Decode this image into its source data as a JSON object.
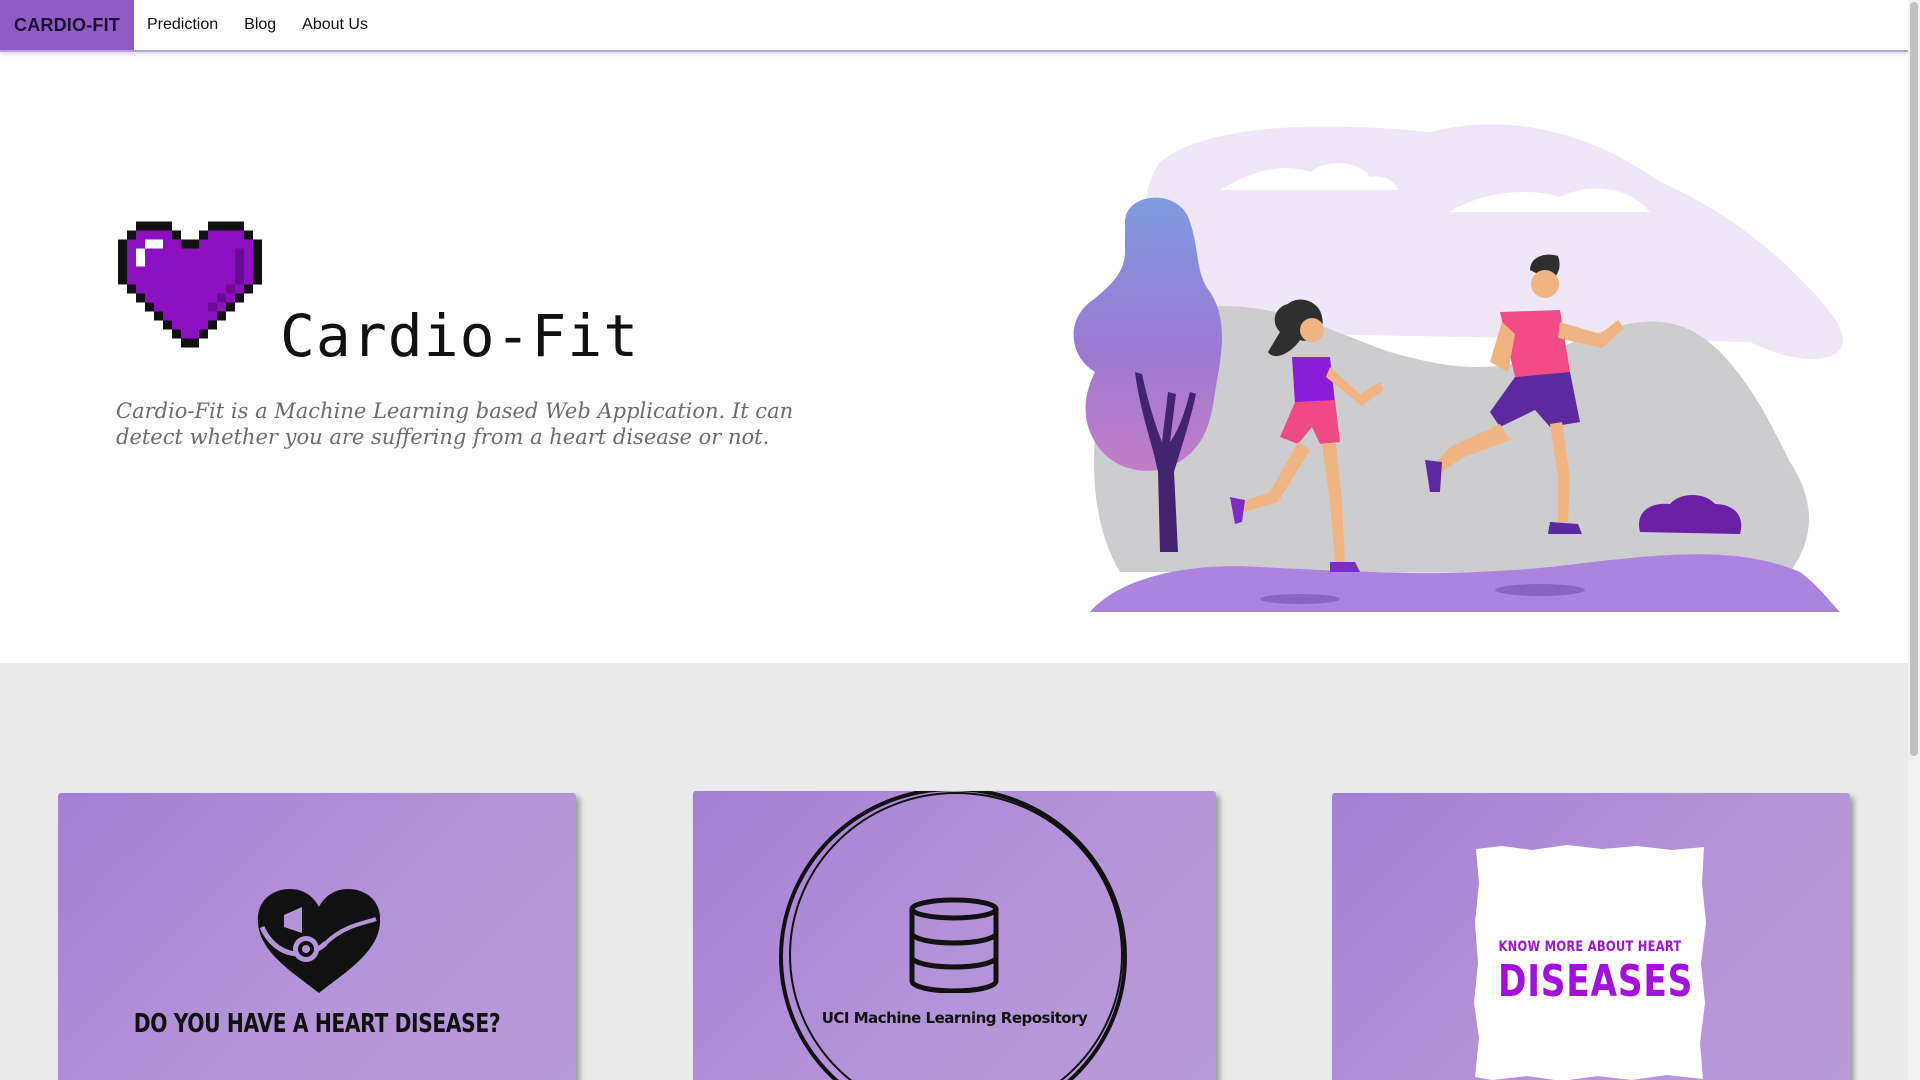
{
  "navbar": {
    "brand": "CARDIO-FIT",
    "links": [
      "Prediction",
      "Blog",
      "About Us"
    ]
  },
  "hero": {
    "title": "Cardio-Fit",
    "tagline": "Cardio-Fit is a Machine Learning based Web Application. It can detect whether you are suffering from a heart disease or not.",
    "logo_icon": "pixel-heart-icon",
    "illustration": "runners-illustration"
  },
  "cards": [
    {
      "icon": "heart-stethoscope-icon",
      "text": "DO YOU HAVE A HEART DISEASE?"
    },
    {
      "icon": "database-icon",
      "text": "UCI Machine Learning Repository"
    },
    {
      "text_small": "KNOW MORE ABOUT HEART",
      "text_big": "DISEASES"
    }
  ],
  "colors": {
    "brand": "#8e5cc4",
    "card_gradient_start": "#a57fd3",
    "card_gradient_end": "#b99cda",
    "accent_text": "#a20fdf",
    "section_background": "#ebebeb"
  }
}
